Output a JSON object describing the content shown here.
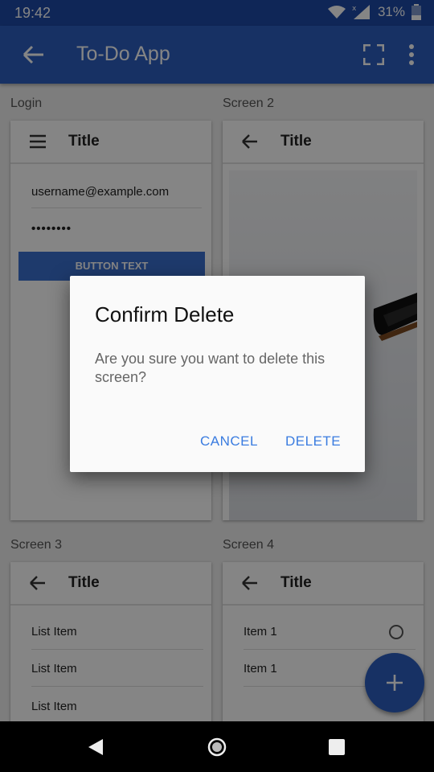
{
  "status_bar": {
    "time": "19:42",
    "battery": "31%"
  },
  "app_bar": {
    "title": "To-Do App"
  },
  "screens": [
    {
      "label": "Login",
      "title": "Title",
      "username": "username@example.com",
      "password": "••••••••",
      "button": "BUTTON TEXT"
    },
    {
      "label": "Screen 2",
      "title": "Title"
    },
    {
      "label": "Screen 3",
      "title": "Title",
      "items": [
        "List Item",
        "List Item",
        "List Item"
      ]
    },
    {
      "label": "Screen 4",
      "title": "Title",
      "items": [
        "Item 1",
        "Item 1"
      ]
    }
  ],
  "dialog": {
    "title": "Confirm Delete",
    "message": "Are you sure you want to delete this screen?",
    "cancel": "CANCEL",
    "delete": "DELETE"
  },
  "colors": {
    "primary": "#2c5fc0",
    "status": "#1e4aa8",
    "accent": "#3a7ce0"
  }
}
